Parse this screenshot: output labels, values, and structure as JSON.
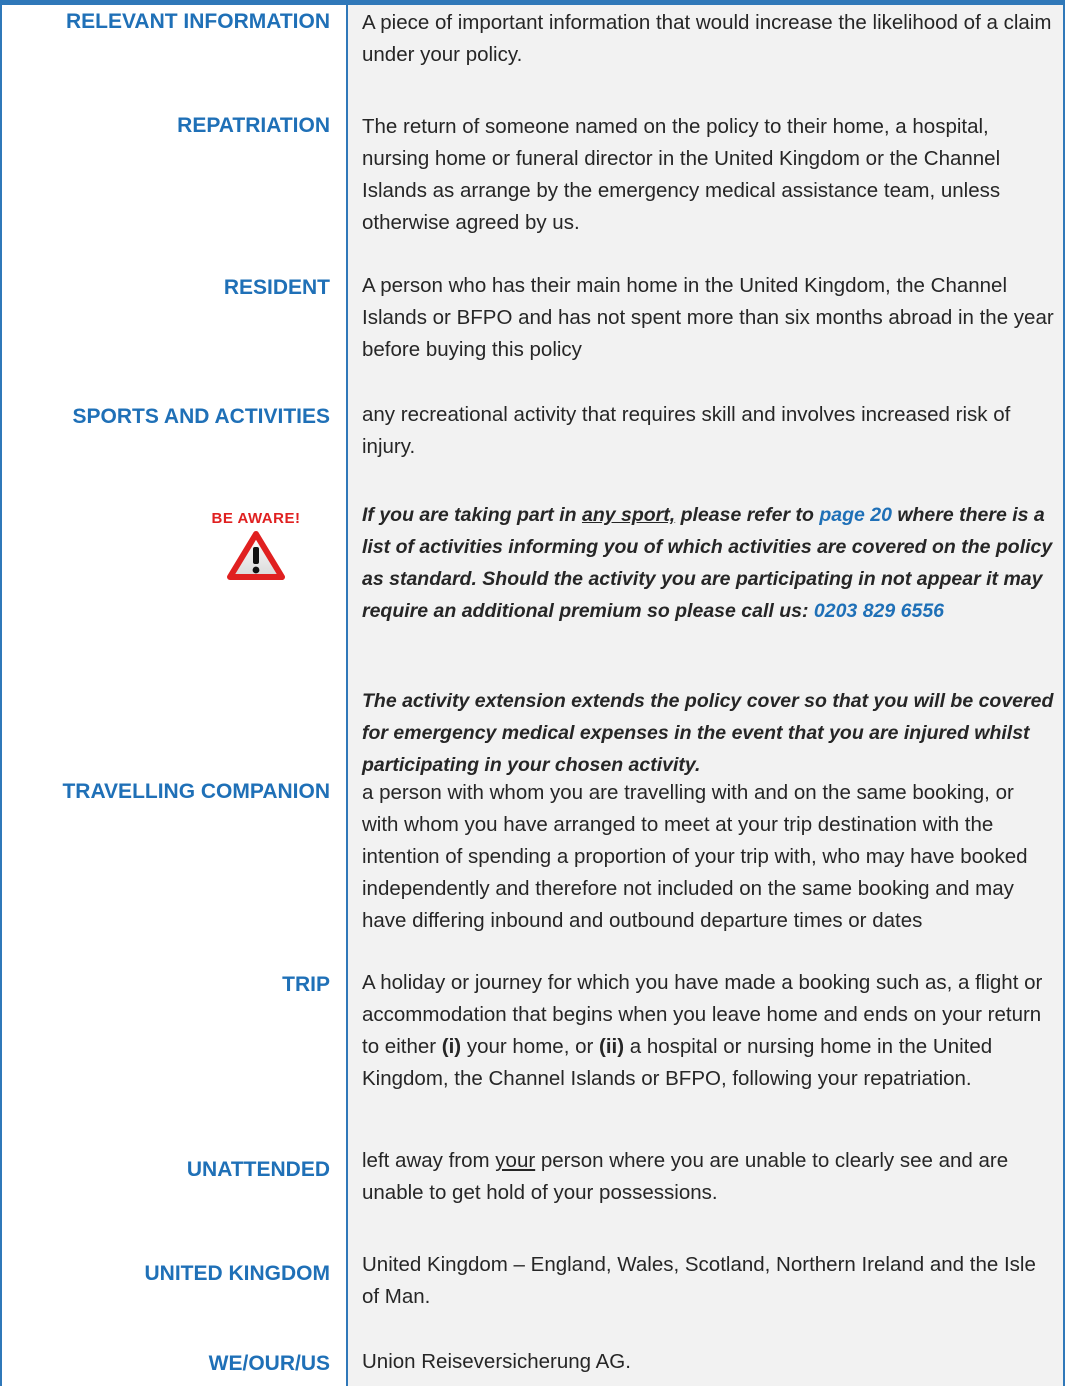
{
  "entries": [
    {
      "term": "RELEVANT INFORMATION",
      "definition": "A piece of important information that would increase the likelihood of a claim under your policy."
    },
    {
      "term": "REPATRIATION",
      "definition": "The return of someone named on the policy to their home, a hospital, nursing home or funeral director in the United Kingdom or the Channel Islands as arrange by the emergency medical assistance team, unless otherwise agreed by us."
    },
    {
      "term": "RESIDENT",
      "definition": "A person who has their main home in the United Kingdom, the Channel Islands or BFPO and has not spent more than six months abroad in the year before buying this policy"
    },
    {
      "term": "SPORTS AND ACTIVITIES",
      "definition": "any recreational activity that requires skill and involves increased risk of injury."
    },
    {
      "term": "TRAVELLING COMPANION",
      "definition": "a person with whom you are travelling with and on the same booking, or with whom you have arranged to meet at your trip destination with the intention of spending a proportion of your trip with, who may have booked independently and therefore not included on the same booking and may have differing inbound and outbound departure times or dates"
    },
    {
      "term": "TRIP",
      "definition_parts": [
        "A holiday or journey for which you have made a booking such as, a flight or accommodation that begins when you leave home and ends on your return to either ",
        "(i)",
        " your home, or ",
        "(ii)",
        " a hospital or nursing home in the United Kingdom, the Channel Islands or BFPO, following your repatriation."
      ]
    },
    {
      "term": "UNATTENDED",
      "definition_parts": [
        "left away from ",
        "your",
        " person where you are unable to clearly see and are unable to get hold of your possessions."
      ]
    },
    {
      "term": "UNITED KINGDOM",
      "definition": "United Kingdom – England, Wales, Scotland, Northern Ireland and the Isle of Man."
    },
    {
      "term": "WE/OUR/US",
      "definition": "Union Reiseversicherung AG."
    }
  ],
  "be_aware": {
    "label": "BE AWARE!",
    "icon": "warning-triangle-icon",
    "paragraph1_parts": [
      "If you are taking part in ",
      "any sport,",
      " please refer to ",
      "page 20",
      " where there is a list of activities informing you of which activities are covered on the policy as standard. Should the activity you are participating in not appear it may require an additional premium so please call us: ",
      "0203 829 6556"
    ],
    "paragraph2": "The activity extension extends the policy cover so that you will be covered for emergency medical expenses in the event that you are injured whilst participating in your chosen activity."
  },
  "colors": {
    "accent_blue": "#1f70b7",
    "rule_blue": "#2f78b9",
    "panel_grey": "#f2f2f2",
    "warning_red": "#e02020"
  }
}
